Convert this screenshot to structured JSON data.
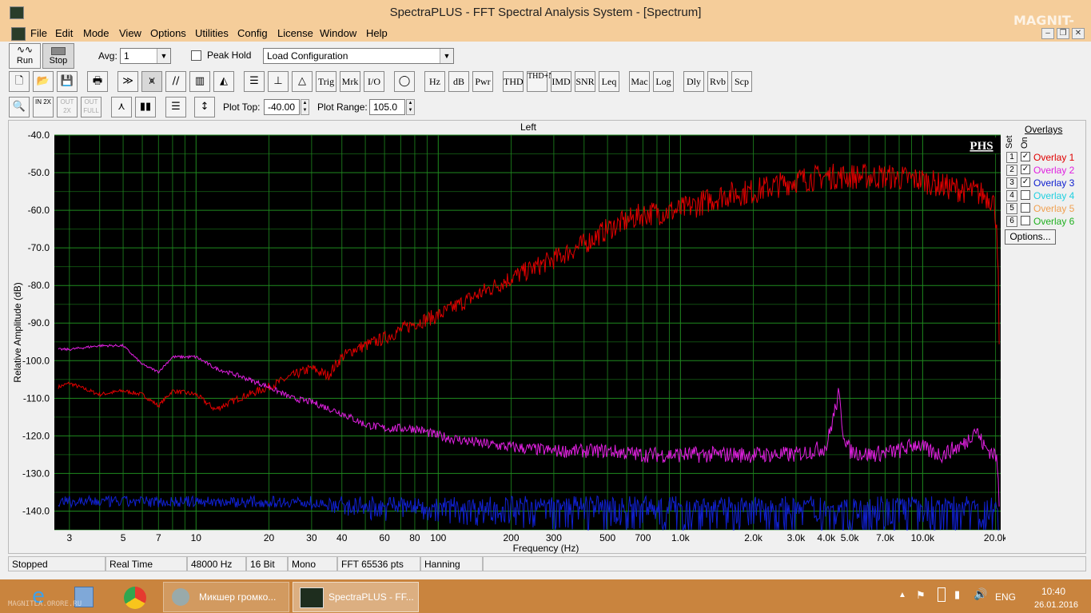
{
  "window": {
    "title": "SpectraPLUS - FFT Spectral Analysis System - [Spectrum]",
    "watermark": "MAGNIT-LA"
  },
  "menu": [
    "File",
    "Edit",
    "Mode",
    "View",
    "Options",
    "Utilities",
    "Config",
    "License",
    "Window",
    "Help"
  ],
  "toolbar1": {
    "run_label": "Run",
    "stop_label": "Stop",
    "avg_label": "Avg:",
    "avg_value": "1",
    "peak_hold_label": "Peak Hold",
    "peak_hold_checked": false,
    "config_value": "Load Configuration"
  },
  "toolbar2": [
    "Trig",
    "Mrk",
    "I/O",
    "Hz",
    "dB",
    "Pwr",
    "THD",
    "THD+N",
    "IMD",
    "SNR",
    "Leq",
    "Mac",
    "Log",
    "Dly",
    "Rvb",
    "Scp"
  ],
  "toolbar3": {
    "plot_top_label": "Plot Top:",
    "plot_top_value": "-40.00",
    "plot_range_label": "Plot Range:",
    "plot_range_value": "105.0",
    "zoom_labels": [
      "IN 2X",
      "OUT 2X",
      "OUT FULL"
    ]
  },
  "graph": {
    "channel_title": "Left",
    "badge": "PHS"
  },
  "overlays": {
    "title": "Overlays",
    "set_header": "Set",
    "on_header": "On",
    "items": [
      {
        "num": "1",
        "label": "Overlay 1",
        "checked": true,
        "color": "#e00000"
      },
      {
        "num": "2",
        "label": "Overlay 2",
        "checked": true,
        "color": "#e020e0"
      },
      {
        "num": "3",
        "label": "Overlay 3",
        "checked": true,
        "color": "#1020d0"
      },
      {
        "num": "4",
        "label": "Overlay 4",
        "checked": false,
        "color": "#20d0e0"
      },
      {
        "num": "5",
        "label": "Overlay 5",
        "checked": false,
        "color": "#f0a050"
      },
      {
        "num": "6",
        "label": "Overlay 6",
        "checked": false,
        "color": "#20b020"
      }
    ],
    "options_label": "Options..."
  },
  "chart_data": {
    "type": "line",
    "title": "Left",
    "xlabel": "Frequency (Hz)",
    "ylabel": "Relative Amplitude (dB)",
    "x_scale": "log",
    "xlim": [
      2.6,
      21000
    ],
    "ylim": [
      -145,
      -40
    ],
    "yticks": [
      -40,
      -50,
      -60,
      -70,
      -80,
      -90,
      -100,
      -110,
      -120,
      -130,
      -140
    ],
    "ytick_labels": [
      "-40.0",
      "-50.0",
      "-60.0",
      "-70.0",
      "-80.0",
      "-90.0",
      "-100.0",
      "-110.0",
      "-120.0",
      "-130.0",
      "-140.0"
    ],
    "xticks": [
      3,
      5,
      7,
      10,
      20,
      30,
      40,
      60,
      80,
      100,
      200,
      300,
      500,
      700,
      1000,
      2000,
      3000,
      4000,
      5000,
      7000,
      10000,
      20000
    ],
    "xtick_labels": [
      "3",
      "5",
      "7",
      "10",
      "20",
      "30",
      "40",
      "60",
      "80",
      "100",
      "200",
      "300",
      "500",
      "700",
      "1.0k",
      "2.0k",
      "3.0k",
      "4.0k",
      "5.0k",
      "7.0k",
      "10.0k",
      "20.0k"
    ],
    "grid": true,
    "background": "#000000",
    "grid_color": "#1f8a1f",
    "series": [
      {
        "name": "Overlay 1",
        "color": "#e00000",
        "x": [
          2.7,
          3,
          4,
          5,
          6,
          7,
          8,
          10,
          12,
          15,
          20,
          25,
          30,
          35,
          40,
          45,
          50,
          60,
          80,
          100,
          150,
          200,
          300,
          400,
          500,
          700,
          1000,
          1500,
          2000,
          3000,
          4000,
          5000,
          7000,
          10000,
          13000,
          16000,
          18000,
          19500,
          20200,
          20500,
          20700
        ],
        "y": [
          -107,
          -106,
          -109,
          -108,
          -109,
          -112,
          -108,
          -109,
          -113,
          -110,
          -107,
          -104,
          -102,
          -104,
          -99,
          -97,
          -96,
          -94,
          -90,
          -88,
          -82,
          -78,
          -73,
          -69,
          -65,
          -61,
          -60,
          -56,
          -55,
          -52,
          -51,
          -51,
          -51,
          -52,
          -54,
          -55,
          -56,
          -57,
          -63,
          -75,
          -98
        ]
      },
      {
        "name": "Overlay 2",
        "color": "#e020e0",
        "x": [
          2.7,
          3,
          4,
          5,
          6,
          7,
          8,
          10,
          12,
          15,
          20,
          25,
          30,
          40,
          50,
          60,
          80,
          100,
          150,
          200,
          300,
          500,
          700,
          1000,
          2000,
          3000,
          4000,
          4500,
          4700,
          5000,
          6000,
          8000,
          9500,
          10500,
          12000,
          15000,
          16500,
          18000,
          20000,
          20500,
          20700
        ],
        "y": [
          -97,
          -97,
          -96,
          -96,
          -101,
          -103,
          -99,
          -99,
          -102,
          -104,
          -107,
          -110,
          -111,
          -114,
          -117,
          -118,
          -118,
          -120,
          -122,
          -123,
          -124,
          -124,
          -125,
          -125,
          -125,
          -125,
          -123,
          -109,
          -119,
          -124,
          -125,
          -124,
          -122,
          -124,
          -125,
          -122,
          -118,
          -123,
          -125,
          -130,
          -140
        ]
      },
      {
        "name": "Overlay 3",
        "color": "#1020d0",
        "x": [
          2.7,
          3,
          4,
          5,
          6,
          7,
          8,
          10,
          12,
          15,
          20,
          30,
          50,
          100,
          200,
          500,
          1000,
          2000,
          5000,
          10000,
          20000,
          20700
        ],
        "y": [
          -120,
          -121,
          -124,
          -126,
          -121,
          -122,
          -122,
          -125,
          -133,
          -137,
          -135,
          -136,
          -138,
          -138,
          -138,
          -138,
          -138,
          -138,
          -138,
          -138,
          -140,
          -141
        ]
      }
    ]
  },
  "status": [
    "Stopped",
    "Real Time",
    "48000 Hz",
    "16 Bit",
    "Mono",
    "FFT 65536 pts",
    "Hanning"
  ],
  "taskbar": {
    "task1": "Микшер громко...",
    "task2": "SpectraPLUS - FF...",
    "lang": "ENG",
    "time": "10:40",
    "date": "26.01.2016",
    "watermark2": "MAGNITLA.ORORE.RU"
  }
}
